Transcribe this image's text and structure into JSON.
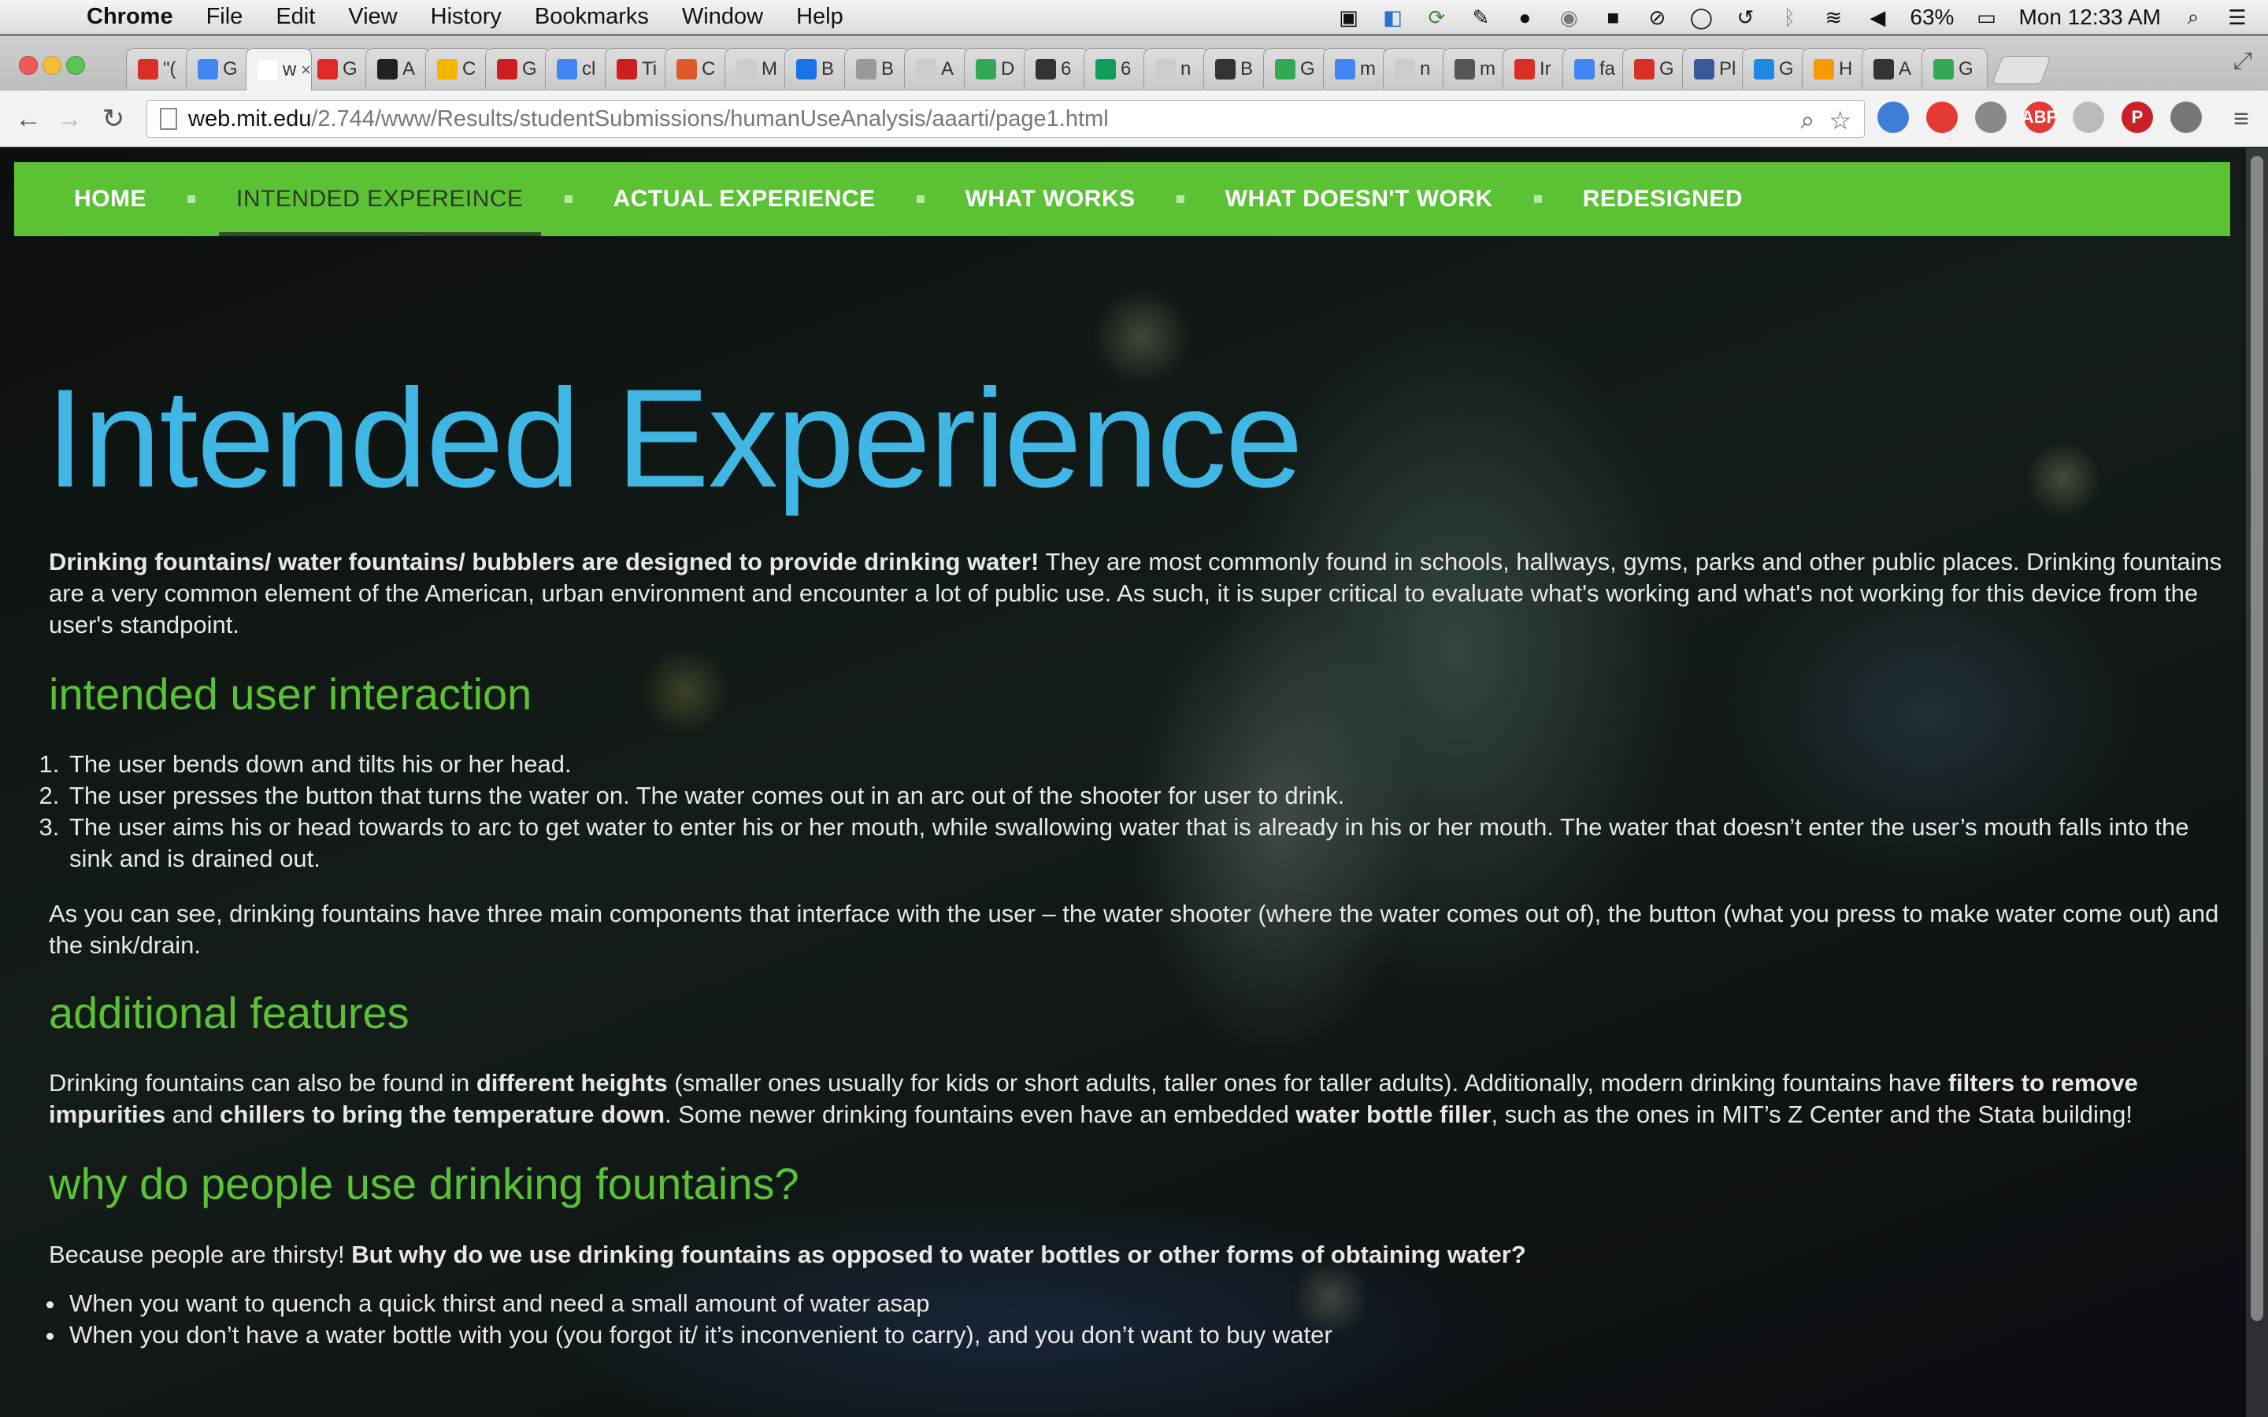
{
  "menubar": {
    "app": "Chrome",
    "items": [
      "File",
      "Edit",
      "View",
      "History",
      "Bookmarks",
      "Window",
      "Help"
    ],
    "battery": "63%",
    "clock": "Mon 12:33 AM"
  },
  "tabs": [
    {
      "title": "\"(",
      "icon": "gmail-icon",
      "color": "#d93025"
    },
    {
      "title": "G",
      "icon": "google-icon",
      "color": "#4285f4"
    },
    {
      "title": "w",
      "icon": "blank-icon",
      "color": "#ffffff",
      "active": true
    },
    {
      "title": "G",
      "icon": "flipboard-icon",
      "color": "#e12828"
    },
    {
      "title": "A",
      "icon": "amazon-icon",
      "color": "#222222"
    },
    {
      "title": "C",
      "icon": "chrome-store-icon",
      "color": "#f4b400"
    },
    {
      "title": "G",
      "icon": "t-icon",
      "color": "#cc1f1f"
    },
    {
      "title": "cl",
      "icon": "google-icon",
      "color": "#4285f4"
    },
    {
      "title": "Ti",
      "icon": "t-icon",
      "color": "#cc1f1f"
    },
    {
      "title": "C",
      "icon": "ring-icon",
      "color": "#e0592a"
    },
    {
      "title": "M",
      "icon": "doc-icon",
      "color": "#cccccc"
    },
    {
      "title": "B",
      "icon": "loading-icon",
      "color": "#1a73e8"
    },
    {
      "title": "B",
      "icon": "gear-icon",
      "color": "#999999"
    },
    {
      "title": "A",
      "icon": "doc-icon",
      "color": "#cccccc"
    },
    {
      "title": "D",
      "icon": "chrome-icon",
      "color": "#34a853"
    },
    {
      "title": "6",
      "icon": "sketch-icon",
      "color": "#333333"
    },
    {
      "title": "6",
      "icon": "drive-icon",
      "color": "#0f9d58"
    },
    {
      "title": "n",
      "icon": "doc-icon",
      "color": "#cccccc"
    },
    {
      "title": "B",
      "icon": "mojo-icon",
      "color": "#333333"
    },
    {
      "title": "G",
      "icon": "maps-icon",
      "color": "#34a853"
    },
    {
      "title": "m",
      "icon": "google-icon",
      "color": "#4285f4"
    },
    {
      "title": "n",
      "icon": "doc-icon",
      "color": "#cccccc"
    },
    {
      "title": "m",
      "icon": "mit-icon",
      "color": "#555555"
    },
    {
      "title": "Ir",
      "icon": "gmail-icon",
      "color": "#d93025"
    },
    {
      "title": "fa",
      "icon": "google-icon",
      "color": "#4285f4"
    },
    {
      "title": "G",
      "icon": "gmail-icon",
      "color": "#d93025"
    },
    {
      "title": "Pl",
      "icon": "facebook-icon",
      "color": "#3b5998"
    },
    {
      "title": "G",
      "icon": "box-icon",
      "color": "#1e88e5"
    },
    {
      "title": "H",
      "icon": "coin-icon",
      "color": "#f59b00"
    },
    {
      "title": "A",
      "icon": "wikipedia-icon",
      "color": "#333333"
    },
    {
      "title": "G",
      "icon": "chrome-icon",
      "color": "#34a853"
    }
  ],
  "toolbar": {
    "url_host": "web.mit.edu",
    "url_path": "/2.744/www/Results/studentSubmissions/humanUseAnalysis/aaarti/page1.html"
  },
  "extensions": [
    {
      "icon": "clock-extension-icon",
      "color": "#3d7fd6",
      "label": ""
    },
    {
      "icon": "stop-hand-icon",
      "color": "#e53935",
      "label": ""
    },
    {
      "icon": "cast-icon",
      "color": "#888888",
      "label": ""
    },
    {
      "icon": "adblock-icon",
      "color": "#e53935",
      "label": "ABP"
    },
    {
      "icon": "globe-icon",
      "color": "#bbbbbb",
      "label": ""
    },
    {
      "icon": "pinterest-icon",
      "color": "#cb2027",
      "label": "P"
    },
    {
      "icon": "wrench-icon",
      "color": "#777777",
      "label": ""
    }
  ],
  "site": {
    "nav": [
      {
        "label": "HOME",
        "active": false
      },
      {
        "label": "INTENDED EXPEREINCE",
        "active": true
      },
      {
        "label": "ACTUAL EXPERIENCE",
        "active": false
      },
      {
        "label": "WHAT WORKS",
        "active": false
      },
      {
        "label": "WHAT DOESN'T WORK",
        "active": false
      },
      {
        "label": "REDESIGNED",
        "active": false
      }
    ],
    "title": "Intended Experience",
    "intro_bold": "Drinking fountains/ water fountains/ bubblers are designed to provide drinking water!",
    "intro_rest": " They are most commonly found in schools, hallways, gyms, parks and other public places. Drinking fountains are a very common element of the American, urban environment and encounter a lot of public use. As such, it is super critical to evaluate what's working and what's not working for this device from the user's standpoint.",
    "h_intended": "intended user interaction",
    "steps": [
      "The user bends down and tilts his or her head.",
      "The user presses the button that turns the water on. The water comes out in an arc out of the shooter for user to drink.",
      "The user aims his or head towards to arc to get water to enter his or her mouth, while swallowing water that is already in his or her mouth. The water that doesn’t enter the user’s mouth falls into the sink and is drained out."
    ],
    "components": "As you can see, drinking fountains have three main components that interface with the user – the water shooter (where the water comes out of), the button (what you press to make water come out) and the sink/drain.",
    "h_additional": "additional features",
    "add_1": "Drinking fountains can also be found in ",
    "add_b1": "different heights",
    "add_2": " (smaller ones usually for kids or short adults, taller ones for taller adults). Additionally, modern drinking fountains have ",
    "add_b2": "filters to remove impurities",
    "add_3": " and ",
    "add_b3": "chillers to bring the temperature down",
    "add_4": ". Some newer drinking fountains even have an embedded ",
    "add_b4": "water bottle filler",
    "add_5": ", such as the ones in MIT’s Z Center and the Stata building!",
    "h_why": "why do people use drinking fountains?",
    "why_1": "Because people are thirsty! ",
    "why_b": "But why do we use drinking fountains as opposed to water bottles or other forms of obtaining water?",
    "why_list": [
      "When you want to quench a quick thirst and need a small amount of water asap",
      "When you don’t have a water bottle with you (you forgot it/ it’s inconvenient to carry), and you don’t want to buy water"
    ]
  },
  "colors": {
    "nav_green": "#5bc236",
    "title_blue": "#3fb6e3",
    "heading_green": "#5bc236"
  }
}
